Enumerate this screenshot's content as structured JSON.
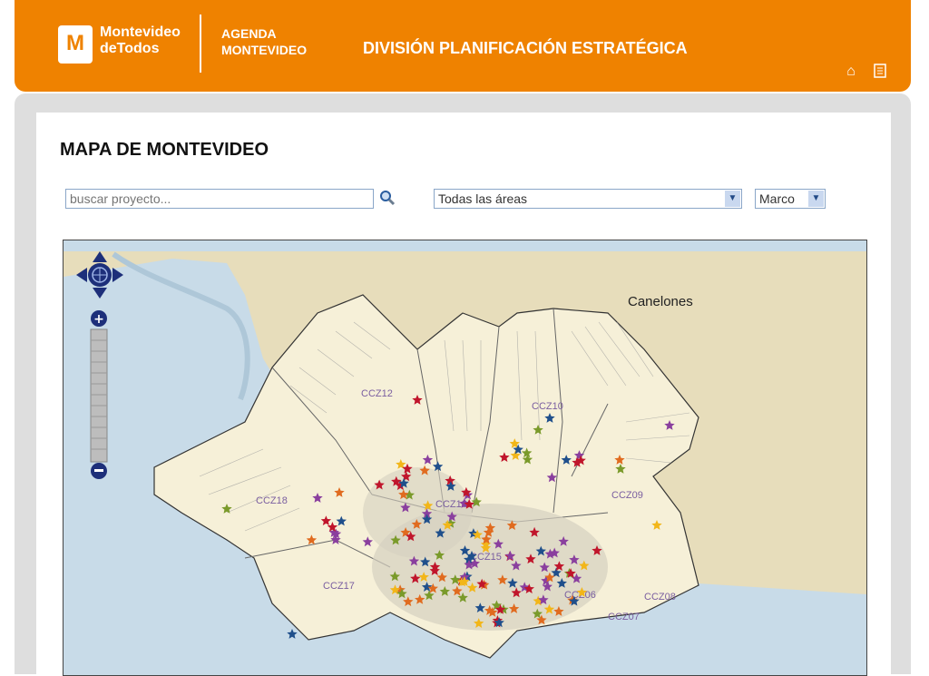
{
  "header": {
    "logo_letter": "M",
    "logo_line1": "Montevideo",
    "logo_line2": "deTodos",
    "agenda_line1": "AGENDA",
    "agenda_line2": "MONTEVIDEO",
    "division": "DIVISIÓN PLANIFICACIÓN ESTRATÉGICA",
    "icons": [
      "home-icon",
      "document-icon"
    ]
  },
  "page": {
    "title": "MAPA DE MONTEVIDEO"
  },
  "search": {
    "placeholder": "buscar proyecto..."
  },
  "filters": {
    "area_selected": "Todas las áreas",
    "month_selected": "Marco"
  },
  "map": {
    "labels": {
      "canelones": "Canelones",
      "ccz12": "CCZ12",
      "ccz10": "CCZ10",
      "ccz09": "CCZ09",
      "ccz18": "CCZ18",
      "ccz13": "CCZ13",
      "ccz15": "CCZ15",
      "ccz17": "CCZ17",
      "ccz08": "CCZ08",
      "ccz06": "CCZ06",
      "ccz07": "CCZ07"
    },
    "star_colors": [
      "#c0152b",
      "#1f4f8b",
      "#8a3f9e",
      "#e06b1f",
      "#7a9a2a",
      "#f2b619"
    ]
  }
}
